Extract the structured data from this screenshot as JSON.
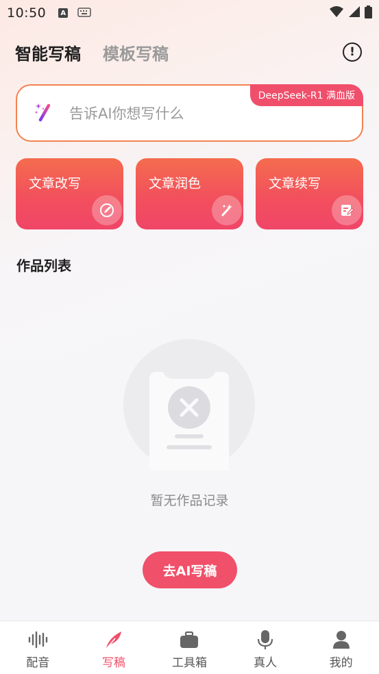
{
  "status_bar": {
    "time": "10:50",
    "icons": [
      "a-notification-icon",
      "keyboard-icon",
      "wifi-icon",
      "signal-icon",
      "battery-icon"
    ]
  },
  "header": {
    "tabs": [
      {
        "label": "智能写稿",
        "active": true
      },
      {
        "label": "模板写稿",
        "active": false
      }
    ],
    "info_icon": "info-circle-icon"
  },
  "prompt": {
    "placeholder": "告诉AI你想写什么",
    "badge": "DeepSeek-R1 满血版",
    "icon": "magic-wand-icon",
    "border_color": "#f2824f"
  },
  "features": [
    {
      "label": "文章改写",
      "icon": "rewrite-pen-icon"
    },
    {
      "label": "文章润色",
      "icon": "polish-wand-icon"
    },
    {
      "label": "文章续写",
      "icon": "continue-edit-icon"
    }
  ],
  "works": {
    "title": "作品列表",
    "empty_text": "暂无作品记录",
    "cta_label": "去AI写稿"
  },
  "bottom_nav": [
    {
      "label": "配音",
      "icon": "soundwave-icon",
      "active": false
    },
    {
      "label": "写稿",
      "icon": "feather-icon",
      "active": true
    },
    {
      "label": "工具箱",
      "icon": "toolbox-icon",
      "active": false
    },
    {
      "label": "真人",
      "icon": "microphone-icon",
      "active": false
    },
    {
      "label": "我的",
      "icon": "person-icon",
      "active": false
    }
  ],
  "colors": {
    "accent": "#f0506a",
    "card_gradient_top": "#f46c4e",
    "card_gradient_bottom": "#f04668",
    "inactive_text": "#9a9a9a"
  }
}
